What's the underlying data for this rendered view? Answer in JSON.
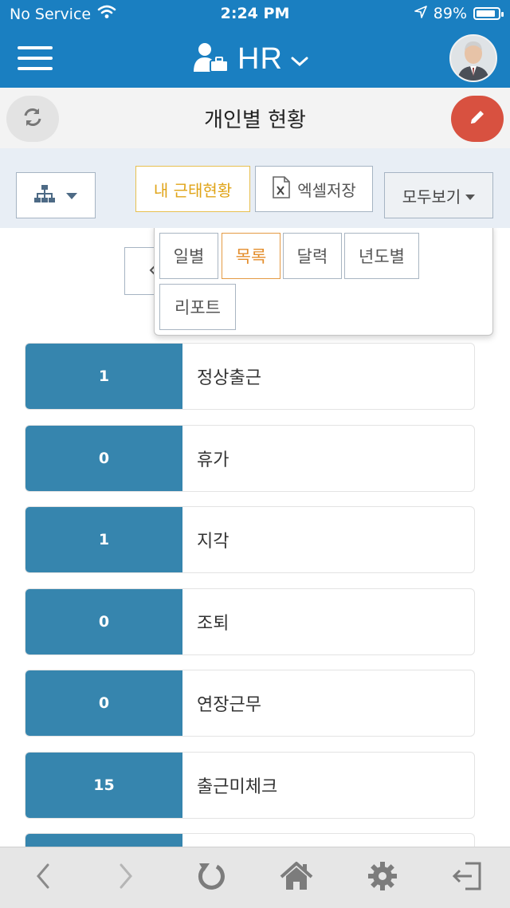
{
  "status_bar": {
    "carrier": "No Service",
    "time": "2:24 PM",
    "battery": "89%",
    "battery_level": 0.89
  },
  "header": {
    "title": "HR",
    "logo_icon": "user-briefcase-icon",
    "menu_icon": "hamburger-icon",
    "avatar_icon": "user-avatar"
  },
  "subheader": {
    "title": "개인별 현황",
    "refresh_icon": "refresh-icon",
    "edit_icon": "pencil-icon"
  },
  "toolbar": {
    "org_icon": "org-chart-icon",
    "my_attendance_label": "내 근태현황",
    "excel_label": "엑셀저장",
    "view_label": "모두보기"
  },
  "view_menu": {
    "items": [
      {
        "label": "일별",
        "active": false
      },
      {
        "label": "목록",
        "active": true
      },
      {
        "label": "달력",
        "active": false
      },
      {
        "label": "년도별",
        "active": false
      },
      {
        "label": "리포트",
        "active": false
      }
    ]
  },
  "stats": [
    {
      "value": "1",
      "label": "정상출근"
    },
    {
      "value": "0",
      "label": "휴가"
    },
    {
      "value": "1",
      "label": "지각"
    },
    {
      "value": "0",
      "label": "조퇴"
    },
    {
      "value": "0",
      "label": "연장근무"
    },
    {
      "value": "15",
      "label": "출근미체크"
    },
    {
      "value": "",
      "label": ""
    }
  ],
  "bottom_nav": [
    "back-icon",
    "forward-icon",
    "reload-icon",
    "home-icon",
    "settings-icon",
    "logout-icon"
  ],
  "colors": {
    "header_blue": "#1a7fc1",
    "stat_blue": "#3685ae",
    "edit_red": "#d85140",
    "accent_yellow": "#e0a418",
    "active_orange": "#e48e2c"
  }
}
